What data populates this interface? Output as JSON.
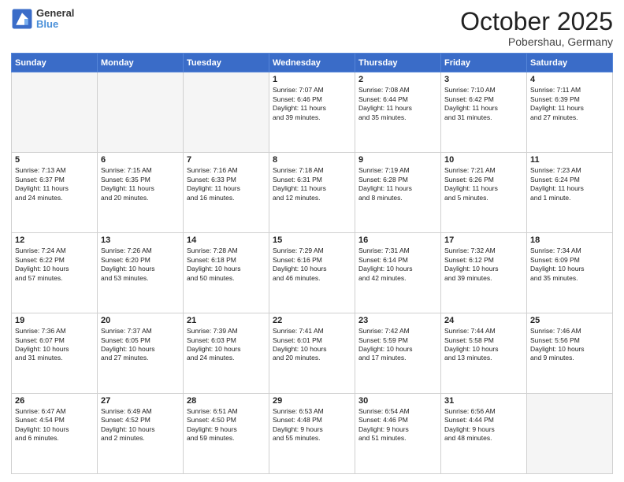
{
  "header": {
    "logo_general": "General",
    "logo_blue": "Blue",
    "month": "October 2025",
    "location": "Pobershau, Germany"
  },
  "weekdays": [
    "Sunday",
    "Monday",
    "Tuesday",
    "Wednesday",
    "Thursday",
    "Friday",
    "Saturday"
  ],
  "weeks": [
    [
      {
        "day": "",
        "info": ""
      },
      {
        "day": "",
        "info": ""
      },
      {
        "day": "",
        "info": ""
      },
      {
        "day": "1",
        "info": "Sunrise: 7:07 AM\nSunset: 6:46 PM\nDaylight: 11 hours\nand 39 minutes."
      },
      {
        "day": "2",
        "info": "Sunrise: 7:08 AM\nSunset: 6:44 PM\nDaylight: 11 hours\nand 35 minutes."
      },
      {
        "day": "3",
        "info": "Sunrise: 7:10 AM\nSunset: 6:42 PM\nDaylight: 11 hours\nand 31 minutes."
      },
      {
        "day": "4",
        "info": "Sunrise: 7:11 AM\nSunset: 6:39 PM\nDaylight: 11 hours\nand 27 minutes."
      }
    ],
    [
      {
        "day": "5",
        "info": "Sunrise: 7:13 AM\nSunset: 6:37 PM\nDaylight: 11 hours\nand 24 minutes."
      },
      {
        "day": "6",
        "info": "Sunrise: 7:15 AM\nSunset: 6:35 PM\nDaylight: 11 hours\nand 20 minutes."
      },
      {
        "day": "7",
        "info": "Sunrise: 7:16 AM\nSunset: 6:33 PM\nDaylight: 11 hours\nand 16 minutes."
      },
      {
        "day": "8",
        "info": "Sunrise: 7:18 AM\nSunset: 6:31 PM\nDaylight: 11 hours\nand 12 minutes."
      },
      {
        "day": "9",
        "info": "Sunrise: 7:19 AM\nSunset: 6:28 PM\nDaylight: 11 hours\nand 8 minutes."
      },
      {
        "day": "10",
        "info": "Sunrise: 7:21 AM\nSunset: 6:26 PM\nDaylight: 11 hours\nand 5 minutes."
      },
      {
        "day": "11",
        "info": "Sunrise: 7:23 AM\nSunset: 6:24 PM\nDaylight: 11 hours\nand 1 minute."
      }
    ],
    [
      {
        "day": "12",
        "info": "Sunrise: 7:24 AM\nSunset: 6:22 PM\nDaylight: 10 hours\nand 57 minutes."
      },
      {
        "day": "13",
        "info": "Sunrise: 7:26 AM\nSunset: 6:20 PM\nDaylight: 10 hours\nand 53 minutes."
      },
      {
        "day": "14",
        "info": "Sunrise: 7:28 AM\nSunset: 6:18 PM\nDaylight: 10 hours\nand 50 minutes."
      },
      {
        "day": "15",
        "info": "Sunrise: 7:29 AM\nSunset: 6:16 PM\nDaylight: 10 hours\nand 46 minutes."
      },
      {
        "day": "16",
        "info": "Sunrise: 7:31 AM\nSunset: 6:14 PM\nDaylight: 10 hours\nand 42 minutes."
      },
      {
        "day": "17",
        "info": "Sunrise: 7:32 AM\nSunset: 6:12 PM\nDaylight: 10 hours\nand 39 minutes."
      },
      {
        "day": "18",
        "info": "Sunrise: 7:34 AM\nSunset: 6:09 PM\nDaylight: 10 hours\nand 35 minutes."
      }
    ],
    [
      {
        "day": "19",
        "info": "Sunrise: 7:36 AM\nSunset: 6:07 PM\nDaylight: 10 hours\nand 31 minutes."
      },
      {
        "day": "20",
        "info": "Sunrise: 7:37 AM\nSunset: 6:05 PM\nDaylight: 10 hours\nand 27 minutes."
      },
      {
        "day": "21",
        "info": "Sunrise: 7:39 AM\nSunset: 6:03 PM\nDaylight: 10 hours\nand 24 minutes."
      },
      {
        "day": "22",
        "info": "Sunrise: 7:41 AM\nSunset: 6:01 PM\nDaylight: 10 hours\nand 20 minutes."
      },
      {
        "day": "23",
        "info": "Sunrise: 7:42 AM\nSunset: 5:59 PM\nDaylight: 10 hours\nand 17 minutes."
      },
      {
        "day": "24",
        "info": "Sunrise: 7:44 AM\nSunset: 5:58 PM\nDaylight: 10 hours\nand 13 minutes."
      },
      {
        "day": "25",
        "info": "Sunrise: 7:46 AM\nSunset: 5:56 PM\nDaylight: 10 hours\nand 9 minutes."
      }
    ],
    [
      {
        "day": "26",
        "info": "Sunrise: 6:47 AM\nSunset: 4:54 PM\nDaylight: 10 hours\nand 6 minutes."
      },
      {
        "day": "27",
        "info": "Sunrise: 6:49 AM\nSunset: 4:52 PM\nDaylight: 10 hours\nand 2 minutes."
      },
      {
        "day": "28",
        "info": "Sunrise: 6:51 AM\nSunset: 4:50 PM\nDaylight: 9 hours\nand 59 minutes."
      },
      {
        "day": "29",
        "info": "Sunrise: 6:53 AM\nSunset: 4:48 PM\nDaylight: 9 hours\nand 55 minutes."
      },
      {
        "day": "30",
        "info": "Sunrise: 6:54 AM\nSunset: 4:46 PM\nDaylight: 9 hours\nand 51 minutes."
      },
      {
        "day": "31",
        "info": "Sunrise: 6:56 AM\nSunset: 4:44 PM\nDaylight: 9 hours\nand 48 minutes."
      },
      {
        "day": "",
        "info": ""
      }
    ]
  ]
}
